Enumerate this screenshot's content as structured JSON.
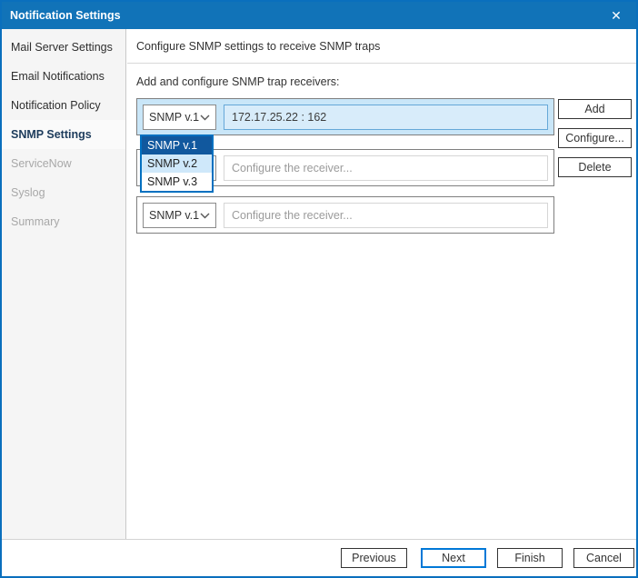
{
  "window": {
    "title": "Notification Settings",
    "close_icon": "✕"
  },
  "sidebar": {
    "items": [
      {
        "label": "Mail Server Settings",
        "state": "enabled"
      },
      {
        "label": "Email Notifications",
        "state": "enabled"
      },
      {
        "label": "Notification Policy",
        "state": "enabled"
      },
      {
        "label": "SNMP Settings",
        "state": "selected"
      },
      {
        "label": "ServiceNow",
        "state": "disabled"
      },
      {
        "label": "Syslog",
        "state": "disabled"
      },
      {
        "label": "Summary",
        "state": "disabled"
      }
    ]
  },
  "main": {
    "header": "Configure SNMP settings to receive SNMP traps",
    "receivers_label": "Add and configure SNMP trap receivers:",
    "receivers": [
      {
        "version": "SNMP v.1",
        "address": "172.17.25.22 : 162",
        "placeholder": "",
        "selected": true
      },
      {
        "version": "SNMP v.1",
        "address": "",
        "placeholder": "Configure the receiver...",
        "selected": false
      },
      {
        "version": "SNMP v.1",
        "address": "",
        "placeholder": "Configure the receiver...",
        "selected": false
      }
    ],
    "version_dropdown": {
      "open": true,
      "options": [
        "SNMP v.1",
        "SNMP v.2",
        "SNMP v.3"
      ],
      "selected_option": "SNMP v.1",
      "hovered_option": "SNMP v.2"
    },
    "actions": {
      "add": "Add",
      "configure": "Configure...",
      "delete": "Delete"
    }
  },
  "footer": {
    "previous": "Previous",
    "next": "Next",
    "finish": "Finish",
    "cancel": "Cancel",
    "default_button": "Next"
  },
  "colors": {
    "titlebar_bg": "#1173b8",
    "window_border": "#0a6fbd",
    "accent": "#0078d7",
    "selected_row_bg": "#c9e6f8",
    "selected_field_bg": "#d8ecfa",
    "selected_field_border": "#66a8d8",
    "dropdown_selected_bg": "#11589e",
    "dropdown_hover_bg": "#cfe8fa",
    "sidebar_bg": "#f5f5f5",
    "sidebar_selected_text": "#1d3c5c",
    "disabled_text": "#a8a8a8"
  }
}
